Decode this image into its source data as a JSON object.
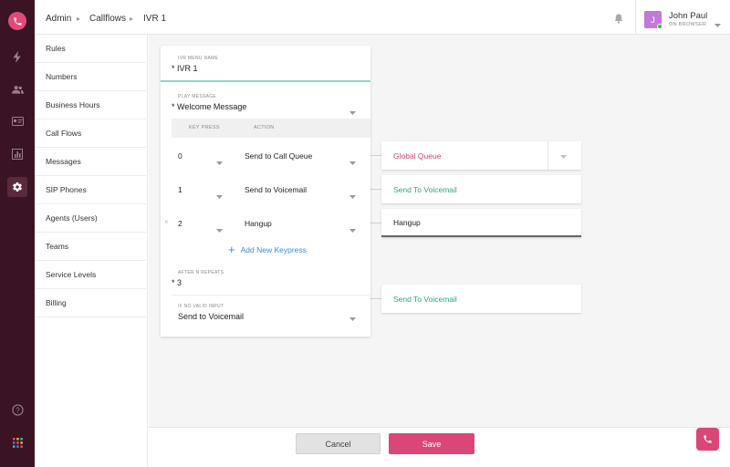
{
  "breadcrumb": [
    "Admin",
    "Callflows",
    "IVR 1"
  ],
  "user": {
    "initial": "J",
    "name": "John Paul",
    "status": "ON BROWSER"
  },
  "subnav": [
    "Rules",
    "Numbers",
    "Business Hours",
    "Call Flows",
    "Messages",
    "SIP Phones",
    "Agents (Users)",
    "Teams",
    "Service Levels",
    "Billing"
  ],
  "ivr": {
    "name_label": "IVR MENU NAME",
    "name_value": "* IVR 1",
    "play_label": "PLAY MESSAGE",
    "play_value": "* Welcome Message",
    "col_key": "KEY PRESS",
    "col_action": "ACTION",
    "rows": [
      {
        "key": "0",
        "action": "Send to Call Queue",
        "destination": "Global Queue"
      },
      {
        "key": "1",
        "action": "Send to Voicemail",
        "destination": "Send To Voicemail"
      },
      {
        "key": "2",
        "action": "Hangup",
        "destination": "Hangup",
        "remove": "×"
      }
    ],
    "add_keypress": "Add New Keypress",
    "repeats_label": "AFTER N REPEATS",
    "repeats_value": "* 3",
    "invalid_label": "IF NO VALID INPUT",
    "invalid_value": "Send to Voicemail",
    "invalid_destination": "Send To Voicemail"
  },
  "footer": {
    "cancel": "Cancel",
    "save": "Save"
  },
  "colors": {
    "brand": "#d94677",
    "rail": "#3a1424",
    "green": "#2aa876",
    "link": "#3a8ad8"
  }
}
